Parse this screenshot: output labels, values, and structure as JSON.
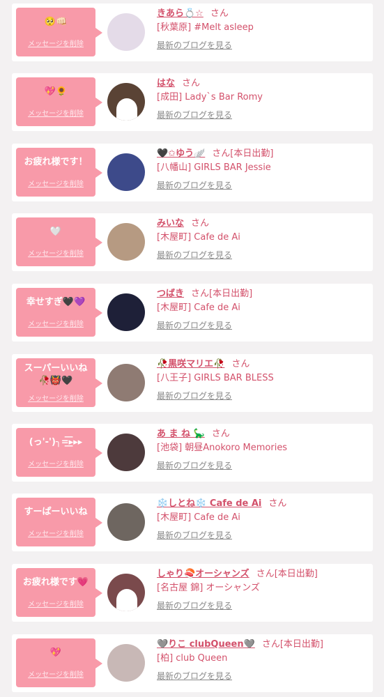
{
  "common": {
    "delete_label": "メッセージを削除",
    "blog_label": "最新のブログを見る",
    "san": "さん"
  },
  "cards": [
    {
      "message": "🥺👊🏻",
      "name": "きあら💍☆",
      "status": "",
      "shop": "[秋葉原] #Melt asleep",
      "avatar": {
        "color": "#e4dbe8",
        "silhouette": false
      }
    },
    {
      "message": "💖🌻",
      "name": "はな",
      "status": "",
      "shop": "[成田] Lady`s Bar Romy",
      "avatar": {
        "color": "#5a4335",
        "silhouette": true
      }
    },
    {
      "message": "お疲れ様です！",
      "name": "🖤✩ゆう🪽",
      "status": "[本日出勤]",
      "shop": "[八幡山] GIRLS BAR Jessie",
      "avatar": {
        "color": "#3d4a8a",
        "silhouette": false
      }
    },
    {
      "message": "🤍",
      "name": "みいな",
      "status": "",
      "shop": "[木屋町] Cafe de Ai",
      "avatar": {
        "color": "#b69a82",
        "silhouette": false
      }
    },
    {
      "message": "幸せすぎ🖤💜",
      "name": "つばき",
      "status": "[本日出勤]",
      "shop": "[木屋町] Cafe de Ai",
      "avatar": {
        "color": "#1e2038",
        "silhouette": false
      }
    },
    {
      "message": "スーパーいいね\n🥀👹🖤",
      "name": "🥀黒咲マリエ🥀",
      "status": "",
      "shop": "[八王子] GIRLS BAR BLESS",
      "avatar": {
        "color": "#8f7b73",
        "silhouette": false
      }
    },
    {
      "message": "(っ'-')╮=͟͟͞͞▸▸▸",
      "name": "あ ま ね 🦕",
      "status": "",
      "shop": "[池袋] 朝昼Anokoro Memories",
      "avatar": {
        "color": "#4d3a3c",
        "silhouette": false
      }
    },
    {
      "message": "すーぱーいいね",
      "name": "❄️しとね❄️ Cafe de Ai",
      "status": "",
      "shop": "[木屋町] Cafe de Ai",
      "avatar": {
        "color": "#6e6660",
        "silhouette": false
      }
    },
    {
      "message": "お疲れ様です💗",
      "name": "しゃり🍣オーシャンズ",
      "status": "[本日出勤]",
      "shop": "[名古屋 錦] オーシャンズ",
      "avatar": {
        "color": "#7a4a4c",
        "silhouette": true
      }
    },
    {
      "message": "💖",
      "name": "🩶りこ clubQueen🩶",
      "status": "[本日出勤]",
      "shop": "[柏] club Queen",
      "avatar": {
        "color": "#c8b8b6",
        "silhouette": false
      }
    }
  ]
}
